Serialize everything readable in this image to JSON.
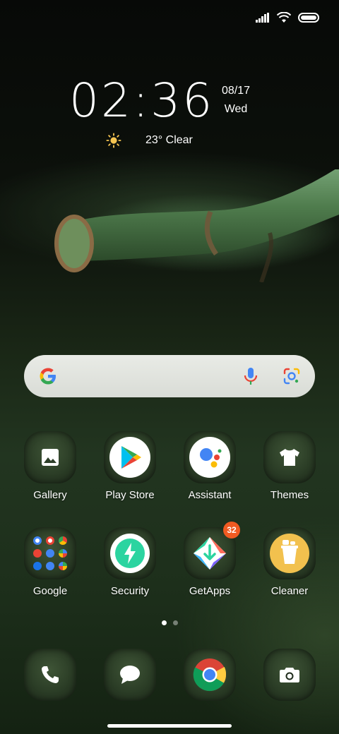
{
  "status": {
    "signal_icon": "signal-bars-icon",
    "wifi_icon": "wifi-icon",
    "battery_icon": "battery-icon"
  },
  "clock": {
    "time": "02:36",
    "date": "08/17",
    "day": "Wed"
  },
  "weather": {
    "icon": "sun-icon",
    "text": "23° Clear"
  },
  "search": {
    "logo": "google-g-icon",
    "mic": "microphone-icon",
    "lens": "google-lens-icon"
  },
  "apps_row1": [
    {
      "label": "Gallery",
      "icon": "gallery-icon"
    },
    {
      "label": "Play Store",
      "icon": "play-store-icon"
    },
    {
      "label": "Assistant",
      "icon": "assistant-icon"
    },
    {
      "label": "Themes",
      "icon": "themes-icon"
    }
  ],
  "apps_row2": [
    {
      "label": "Google",
      "icon": "google-folder-icon"
    },
    {
      "label": "Security",
      "icon": "security-icon"
    },
    {
      "label": "GetApps",
      "icon": "getapps-icon",
      "badge": "32"
    },
    {
      "label": "Cleaner",
      "icon": "cleaner-icon"
    }
  ],
  "dock": [
    {
      "icon": "phone-icon"
    },
    {
      "icon": "messages-icon"
    },
    {
      "icon": "chrome-icon"
    },
    {
      "icon": "camera-icon"
    }
  ],
  "page_indicator": {
    "pages": 2,
    "current": 1
  },
  "colors": {
    "badge": "#f05a22",
    "accent_green": "#2bd4a0",
    "cleaner_yellow": "#f2c14e"
  }
}
